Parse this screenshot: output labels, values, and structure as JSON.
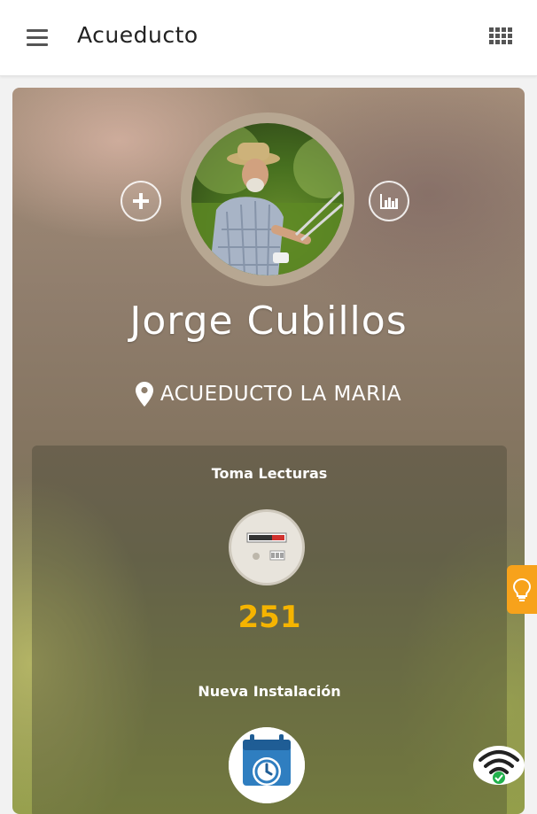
{
  "appbar": {
    "title": "Acueducto",
    "menu_icon": "hamburger-menu-icon",
    "apps_icon": "grid-apps-icon"
  },
  "profile": {
    "name": "Jorge Cubillos",
    "location": "ACUEDUCTO LA MARIA",
    "location_icon": "map-pin-icon",
    "avatar": "user-photo-gardener",
    "add_icon": "plus-icon",
    "stats_icon": "bar-chart-icon"
  },
  "sections": {
    "readings_title": "Toma Lecturas",
    "readings_icon": "water-meter-icon",
    "readings_count": "251",
    "install_title": "Nueva Instalación",
    "install_icon": "calendar-clock-icon"
  },
  "floating": {
    "tip_icon": "lightbulb-icon",
    "wifi_icon": "wifi-connected-icon"
  },
  "colors": {
    "accent_orange": "#f7a21b",
    "count_yellow": "#f5b400",
    "calendar_blue": "#2f7ec0",
    "connected_green": "#22b14c"
  }
}
